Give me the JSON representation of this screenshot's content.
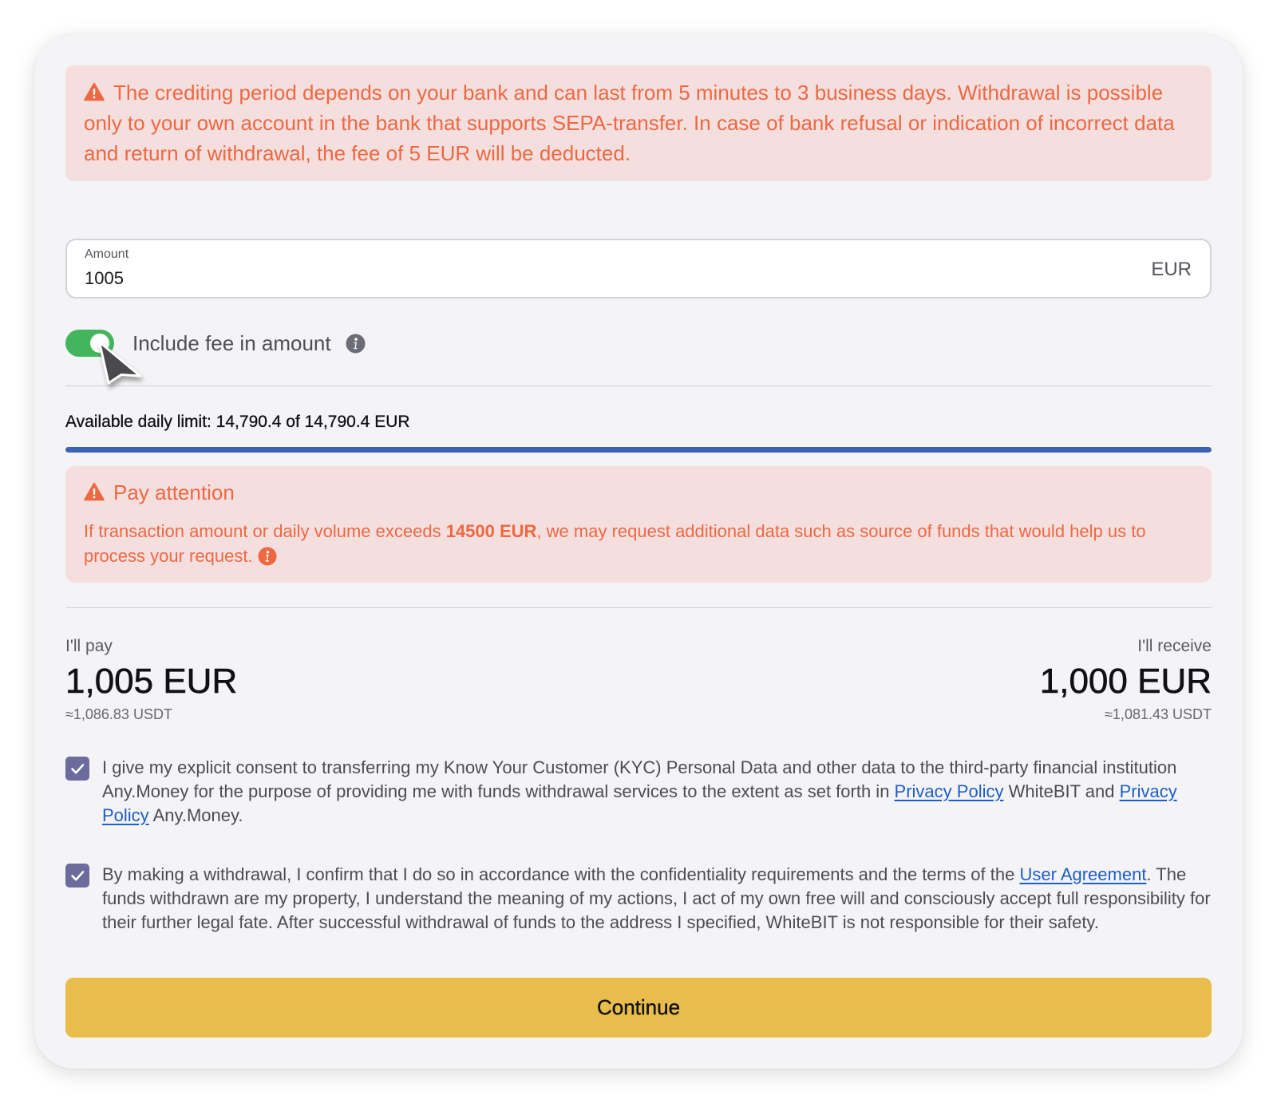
{
  "theme": {
    "notice_background": "#f4dfde",
    "notice_text": "#ee6842",
    "card_background": "#f4f4f6",
    "toggle_on": "#43b65d",
    "progress_fill": "#3b63b4",
    "checkbox": "#6b6c9d",
    "link": "#1f5ec8",
    "button": "#e9bd4b"
  },
  "notice": {
    "icon": "warning-icon",
    "text": "The crediting period depends on your bank and can last from 5 minutes to 3 business days. Withdrawal is possible only to your own account in the bank that supports SEPA-transfer. In case of bank refusal or indication of incorrect data and return of withdrawal, the fee of 5 EUR will be deducted."
  },
  "amount_field": {
    "label": "Amount",
    "value": "1005",
    "currency": "EUR"
  },
  "fee_toggle": {
    "label": "Include fee in amount",
    "checked": true,
    "info_icon": "info-icon"
  },
  "daily_limit": {
    "text": "Available daily limit: 14,790.4 of 14,790.4 EUR",
    "fill_fraction": 1
  },
  "attention": {
    "icon": "warning-icon",
    "title": "Pay attention",
    "text_before": "If transaction amount or daily volume exceeds ",
    "text_bold": "14500 EUR",
    "text_after": ", we may request additional data such as source of funds that would help us to process your request.",
    "info_icon": "info-icon"
  },
  "summary": {
    "pay": {
      "label": "I'll pay",
      "amount": "1,005 EUR",
      "approx": "≈1,086.83 USDT"
    },
    "receive": {
      "label": "I'll receive",
      "amount": "1,000 EUR",
      "approx": "≈1,081.43 USDT"
    }
  },
  "consents": [
    {
      "checked": true,
      "text_1": "I give my explicit consent to transferring my Know Your Customer (KYC) Personal Data and other data to the third-party financial institution Any.Money for the purpose of providing me with funds withdrawal services to the extent as set forth in ",
      "link_1": "Privacy Policy",
      "text_2": " WhiteBIT and ",
      "link_2": "Privacy Policy",
      "text_3": " Any.Money."
    },
    {
      "checked": true,
      "text_1": "By making a withdrawal, I confirm that I do so in accordance with the confidentiality requirements and the terms of the ",
      "link_1": "User Agreement",
      "text_2": ". The funds withdrawn are my property, I understand the meaning of my actions, I act of my own free will and consciously accept full responsibility for their further legal fate. After successful withdrawal of funds to the address I specified, WhiteBIT is not responsible for their safety."
    }
  ],
  "continue_button": {
    "label": "Continue"
  },
  "cursor": {
    "icon": "mouse-pointer-icon"
  }
}
